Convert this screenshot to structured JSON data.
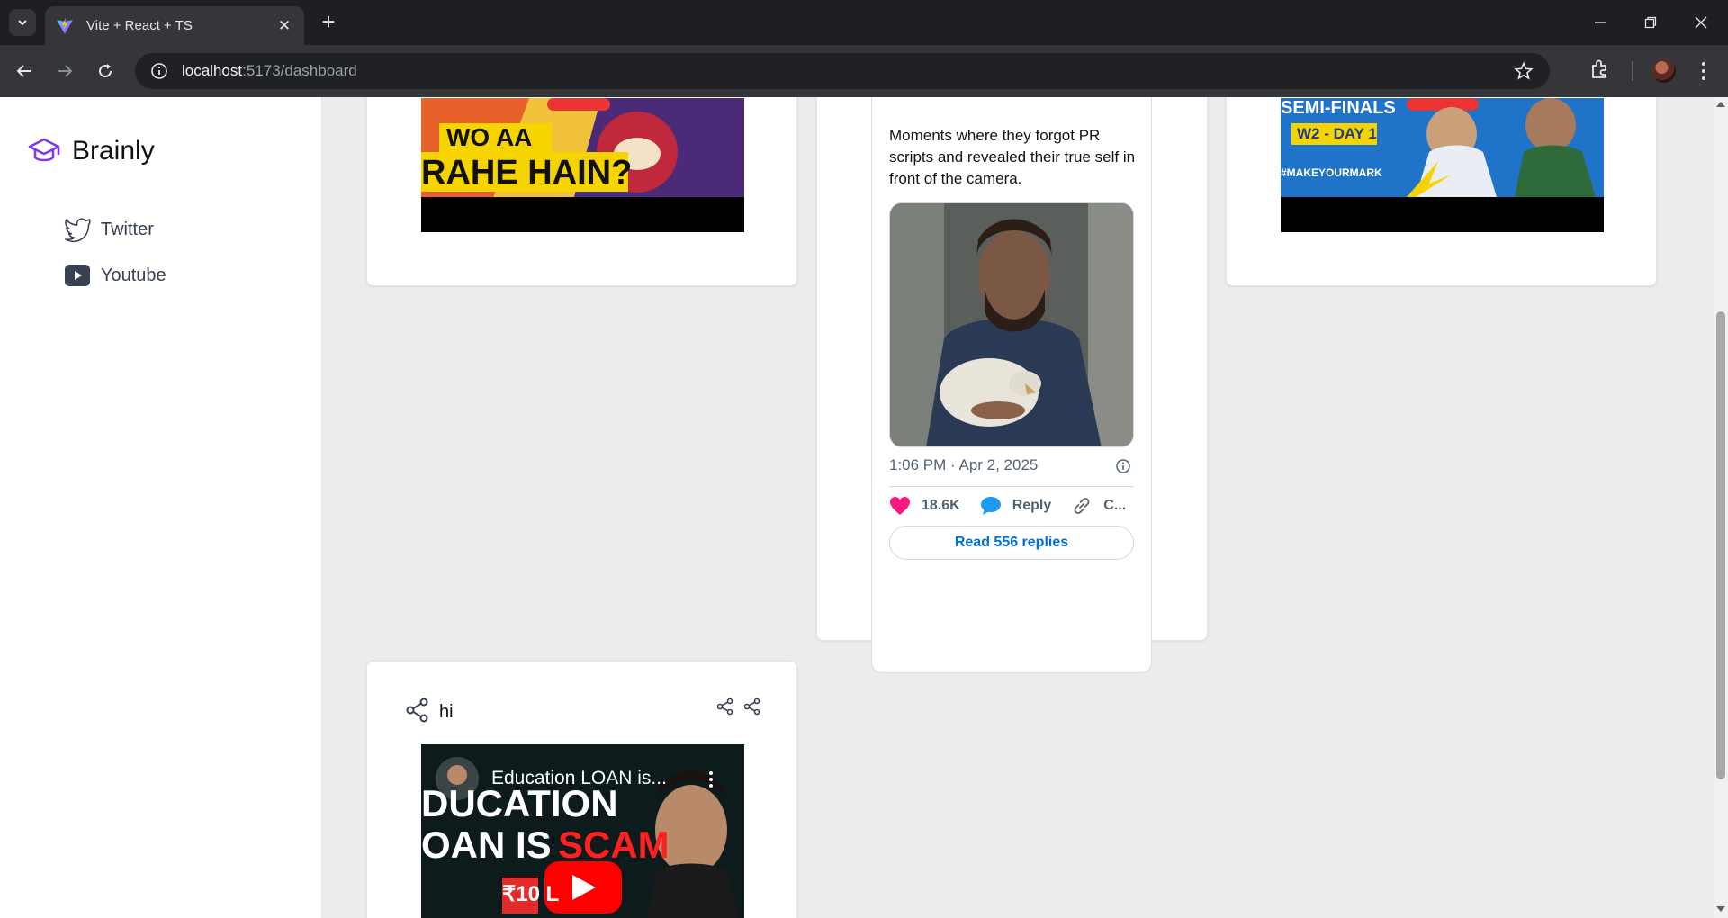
{
  "browser": {
    "tab_title": "Vite + React + TS",
    "url_host": "localhost",
    "url_path": ":5173/dashboard"
  },
  "sidebar": {
    "brand": "Brainly",
    "items": [
      {
        "label": "Twitter",
        "icon": "twitter-icon"
      },
      {
        "label": "Youtube",
        "icon": "youtube-icon"
      }
    ]
  },
  "cards": {
    "top_left_thumb_text_1": "WO AA",
    "top_left_thumb_text_2": "RAHE HAIN?",
    "top_right_thumb_text_1": "SEMI-FINALS",
    "top_right_thumb_text_2": "W2 - DAY 1",
    "top_right_thumb_text_3": "#MAKEYOURMARK",
    "bottom_card": {
      "title": "hi",
      "video_title": "Education LOAN is...",
      "thumb_text_1": "DUCATION",
      "thumb_text_2": "OAN IS",
      "thumb_text_3": "SCAM",
      "thumb_text_4": "₹10 L"
    }
  },
  "tweet": {
    "text": "Moments where they forgot PR scripts and revealed their true self in front of the camera.",
    "time": "1:06 PM · Apr 2, 2025",
    "likes": "18.6K",
    "reply": "Reply",
    "copy": "C...",
    "read_replies": "Read 556 replies"
  },
  "colors": {
    "brand": "#7c3aed",
    "tweet_link": "#006fd6",
    "heart": "#f91880",
    "reply_bubble": "#1d9bf0"
  }
}
